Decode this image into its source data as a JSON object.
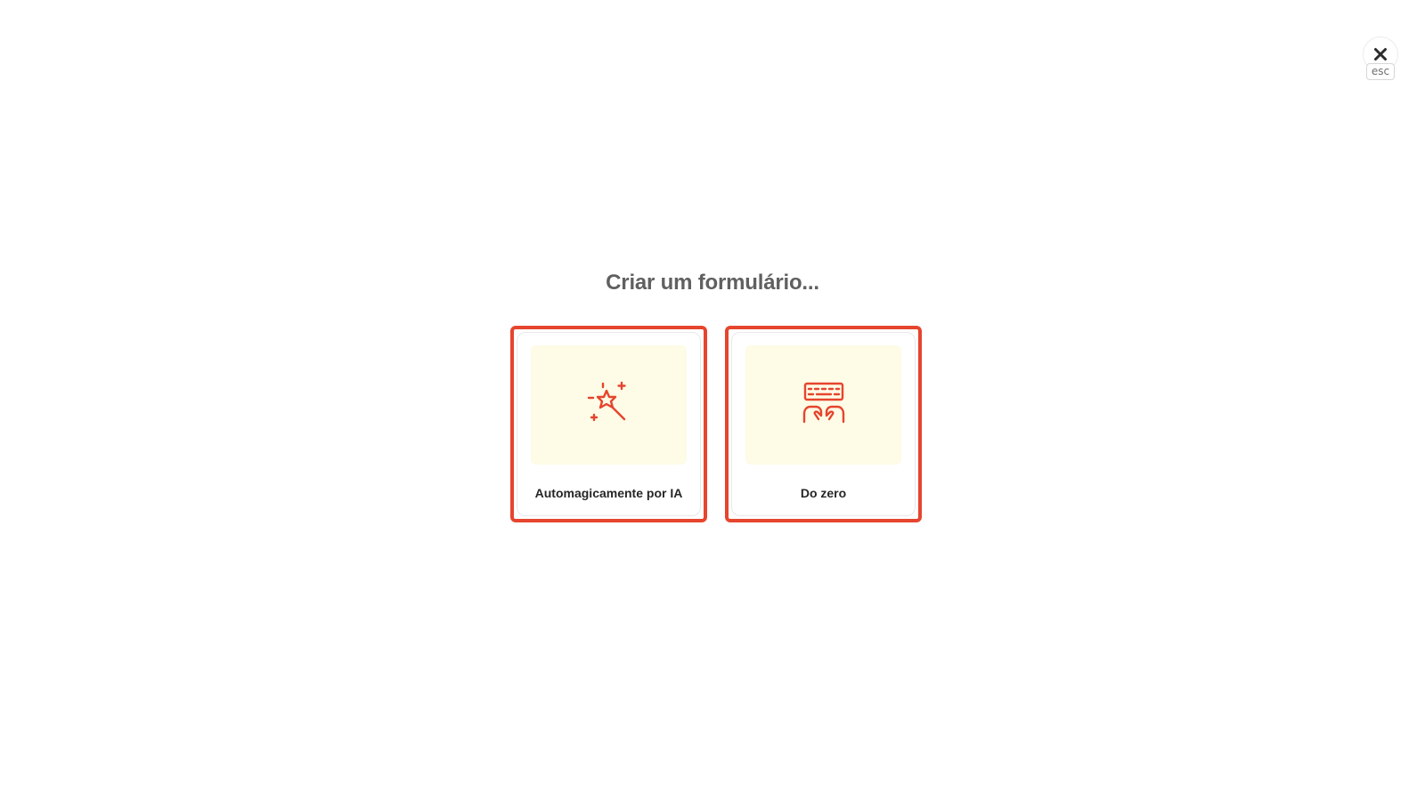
{
  "modal": {
    "title": "Criar um formulário...",
    "close": {
      "icon": "close-icon",
      "shortcut_label": "esc"
    },
    "options": [
      {
        "label": "Automagicamente por IA",
        "icon": "magic-wand-icon"
      },
      {
        "label": "Do zero",
        "icon": "keyboard-hands-icon"
      }
    ]
  },
  "colors": {
    "accent": "#e6452e",
    "card_image_bg": "#fefbe6",
    "title": "#606060",
    "label": "#262626"
  }
}
